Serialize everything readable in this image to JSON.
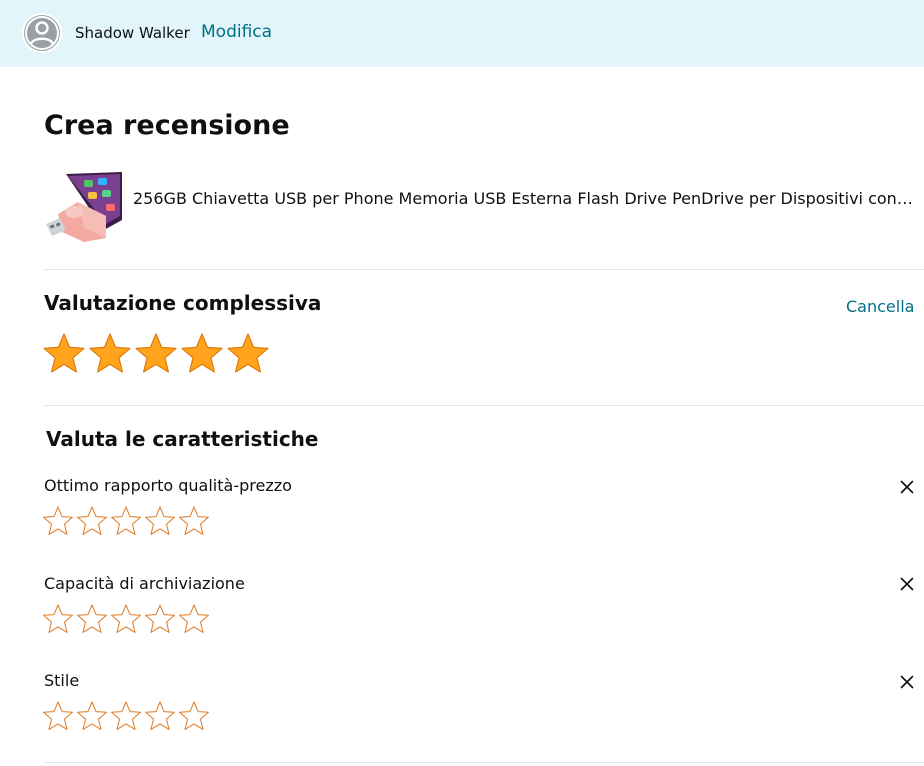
{
  "header": {
    "user_name": "Shadow Walker",
    "edit_label": "Modifica",
    "avatar_icon": "user-avatar-icon",
    "background": "#e1f5fa"
  },
  "page": {
    "title": "Crea recensione"
  },
  "product": {
    "title": "256GB Chiavetta USB per Phone Memoria USB Esterna Flash Drive PenDrive per Dispositivi con i…",
    "thumbnail_icon": "pink-usb-flash-drive-icon"
  },
  "overall_rating": {
    "title": "Valutazione complessiva",
    "clear_label": "Cancella",
    "rating": 5,
    "max": 5,
    "star_color": "#ffa41c"
  },
  "features": {
    "title": "Valuta le caratteristiche",
    "items": [
      {
        "label": "Ottimo rapporto qualità-prezzo",
        "rating": 0,
        "max": 5
      },
      {
        "label": "Capacità di archiviazione",
        "rating": 0,
        "max": 5
      },
      {
        "label": "Stile",
        "rating": 0,
        "max": 5
      }
    ],
    "empty_star_color": "#de7921",
    "close_icon": "close-icon"
  },
  "colors": {
    "link": "#007185",
    "text": "#0f1111",
    "divider": "#e3e6e6"
  }
}
